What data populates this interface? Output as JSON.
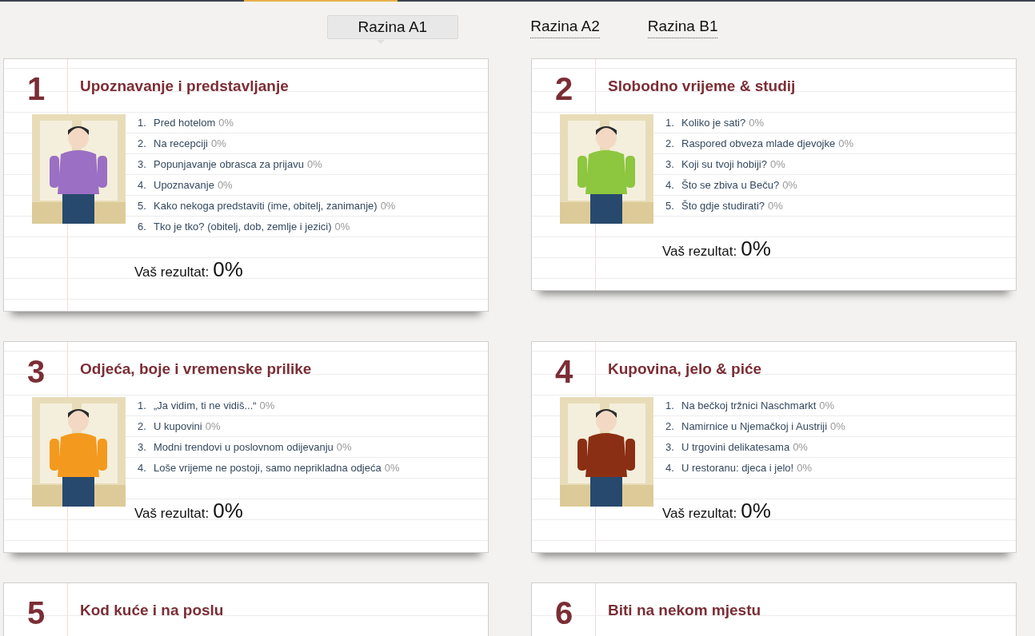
{
  "tabs": [
    {
      "label": "Razina A1",
      "selected": true
    },
    {
      "label": "Razina A2",
      "selected": false
    },
    {
      "label": "Razina B1",
      "selected": false
    }
  ],
  "units": [
    {
      "number": "1",
      "title": "Upoznavanje i predstavljanje",
      "picture": {
        "kind": "picture"
      },
      "lessons": [
        {
          "index": "1.",
          "title": "Pred hotelom",
          "score": "0%"
        },
        {
          "index": "2.",
          "title": "Na recepciji",
          "score": "0%"
        },
        {
          "index": "3.",
          "title": "Popunjavanje obrasca za prijavu",
          "score": "0%"
        },
        {
          "index": "4.",
          "title": "Upoznavanje",
          "score": "0%"
        },
        {
          "index": "5.",
          "title": "Kako nekoga predstaviti (ime, obitelj, zanimanje)",
          "score": "0%"
        },
        {
          "index": "6.",
          "title": "Tko je tko? (obitelj, dob, zemlje i jezici)",
          "score": "0%"
        }
      ],
      "result_label": "Vaš rezultat:",
      "result": "0%"
    },
    {
      "number": "2",
      "title": "Slobodno vrijeme & studij",
      "picture": {
        "kind": "picture"
      },
      "lessons": [
        {
          "index": "1.",
          "title": "Koliko je sati?",
          "score": "0%"
        },
        {
          "index": "2.",
          "title": "Raspored obveza mlade djevojke",
          "score": "0%"
        },
        {
          "index": "3.",
          "title": "Koji su tvoji hobiji?",
          "score": "0%"
        },
        {
          "index": "4.",
          "title": "Što se zbiva u Beču?",
          "score": "0%"
        },
        {
          "index": "5.",
          "title": "Što gdje studirati?",
          "score": "0%"
        }
      ],
      "result_label": "Vaš rezultat:",
      "result": "0%"
    },
    {
      "number": "3",
      "title": "Odjeća, boje i vremenske prilike",
      "picture": {
        "kind": "picture"
      },
      "lessons": [
        {
          "index": "1.",
          "title": "„Ja vidim, ti ne vidiš...“",
          "score": "0%"
        },
        {
          "index": "2.",
          "title": "U kupovini",
          "score": "0%"
        },
        {
          "index": "3.",
          "title": "Modni trendovi u poslovnom odijevanju",
          "score": "0%"
        },
        {
          "index": "4.",
          "title": "Loše vrijeme ne postoji, samo neprikladna odjeća",
          "score": "0%"
        }
      ],
      "result_label": "Vaš rezultat:",
      "result": "0%"
    },
    {
      "number": "4",
      "title": "Kupovina, jelo & piće",
      "picture": {
        "kind": "picture"
      },
      "lessons": [
        {
          "index": "1.",
          "title": "Na bečkoj tržnici Naschmarkt",
          "score": "0%"
        },
        {
          "index": "2.",
          "title": "Namirnice u Njemačkoj i Austriji",
          "score": "0%"
        },
        {
          "index": "3.",
          "title": "U trgovini delikatesama",
          "score": "0%"
        },
        {
          "index": "4.",
          "title": "U restoranu: djeca i jelo!",
          "score": "0%"
        }
      ],
      "result_label": "Vaš rezultat:",
      "result": "0%"
    },
    {
      "number": "5",
      "title": "Kod kuće i na poslu"
    },
    {
      "number": "6",
      "title": "Biti na nekom mjestu"
    }
  ]
}
